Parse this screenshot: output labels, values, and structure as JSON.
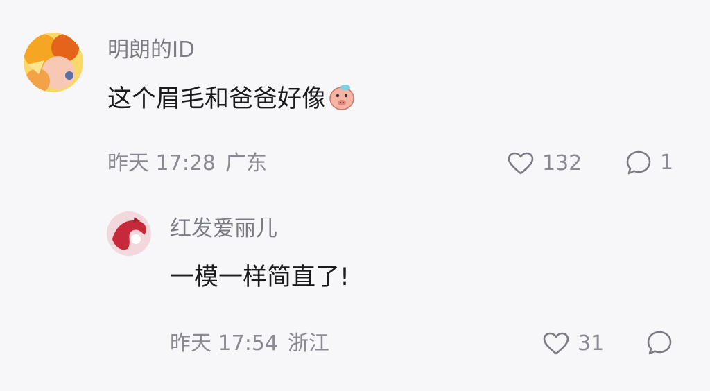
{
  "comments": [
    {
      "username": "明朗的ID",
      "text": "这个眉毛和爸爸好像",
      "emoji": "pig-face-emoji",
      "time": "昨天 17:28",
      "location": "广东",
      "likes": "132",
      "replies": "1",
      "avatar_colors": [
        "#f5a623",
        "#e3641a",
        "#f8d86a"
      ]
    },
    {
      "username": "红发爱丽儿",
      "text": "一模一样简直了!",
      "time": "昨天 17:54",
      "location": "浙江",
      "likes": "31",
      "replies": "",
      "avatar_colors": [
        "#f2d7dc",
        "#c62a3a",
        "#ffffff"
      ]
    }
  ],
  "icons": {
    "like": "heart-outline-icon",
    "reply": "speech-bubble-icon"
  }
}
